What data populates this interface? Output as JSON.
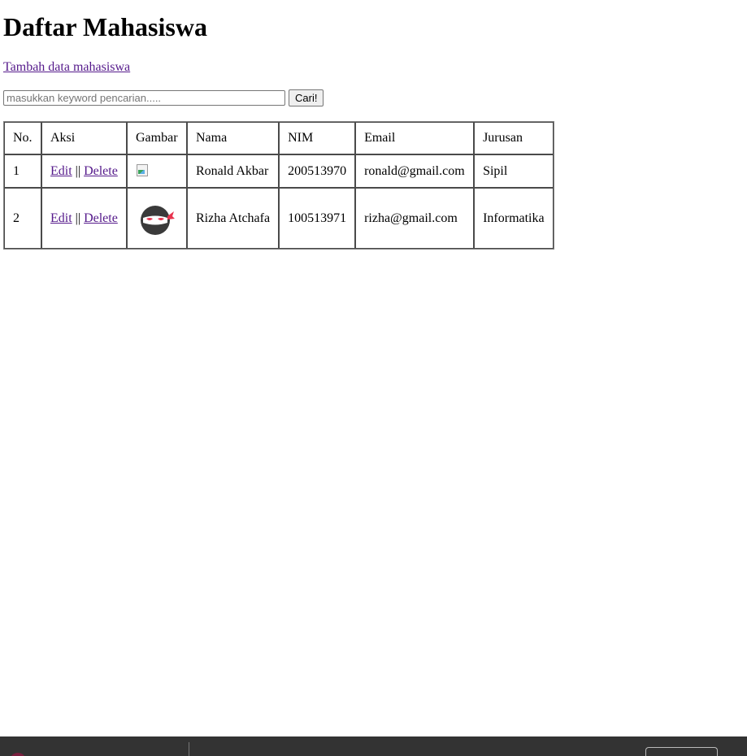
{
  "page": {
    "title": "Daftar Mahasiswa",
    "add_link": "Tambah data mahasiswa"
  },
  "search": {
    "placeholder": "masukkan keyword pencarian.....",
    "value": "",
    "button": "Cari!"
  },
  "table": {
    "headers": [
      "No.",
      "Aksi",
      "Gambar",
      "Nama",
      "NIM",
      "Email",
      "Jurusan"
    ],
    "rows": [
      {
        "no": "1",
        "edit": "Edit",
        "separator": "||",
        "delete": "Delete",
        "image": "broken-image-icon",
        "nama": "Ronald Akbar",
        "nim": "200513970",
        "email": "ronald@gmail.com",
        "jurusan": "Sipil"
      },
      {
        "no": "2",
        "edit": "Edit",
        "separator": "||",
        "delete": "Delete",
        "image": "ninja-avatar-icon",
        "nama": "Rizha Atchafa",
        "nim": "100513971",
        "email": "rizha@gmail.com",
        "jurusan": "Informatika"
      }
    ]
  },
  "colors": {
    "link": "#551a8b",
    "bottom_bar": "#333333",
    "avatar_face": "#3a3a3a",
    "avatar_eyes": "#e8344e"
  }
}
